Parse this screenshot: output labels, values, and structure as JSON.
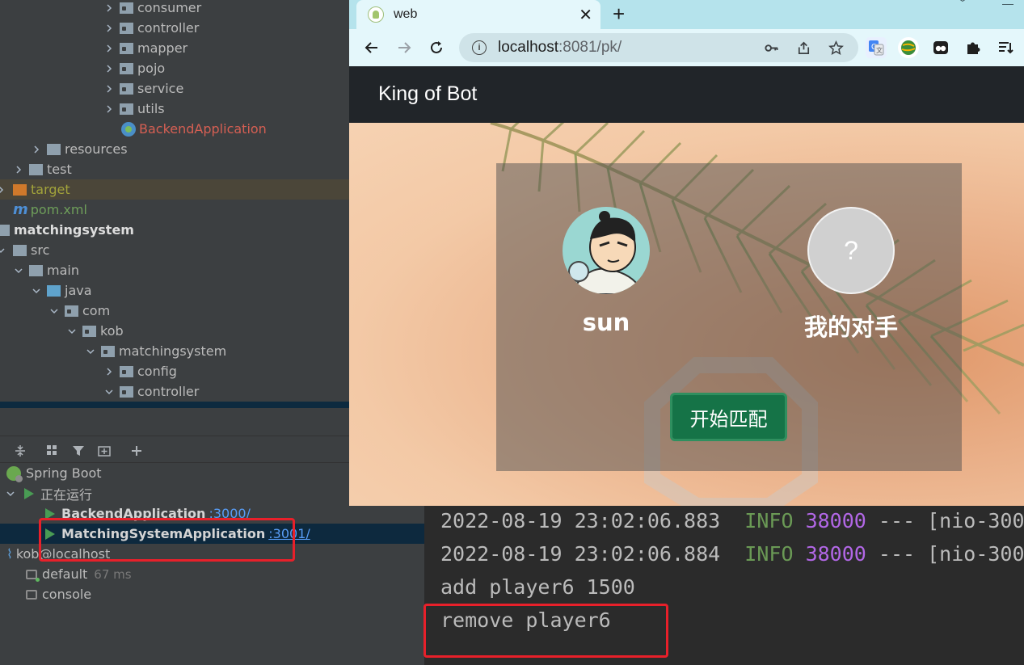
{
  "project_tree": {
    "items": [
      {
        "label": "consumer"
      },
      {
        "label": "controller"
      },
      {
        "label": "mapper"
      },
      {
        "label": "pojo"
      },
      {
        "label": "service"
      },
      {
        "label": "utils"
      },
      {
        "label": "BackendApplication"
      },
      {
        "label": "resources"
      },
      {
        "label": "test"
      },
      {
        "label": "target"
      },
      {
        "label": "pom.xml"
      },
      {
        "label": "matchingsystem"
      },
      {
        "label": "src"
      },
      {
        "label": "main"
      },
      {
        "label": "java"
      },
      {
        "label": "com"
      },
      {
        "label": "kob"
      },
      {
        "label": "matchingsystem"
      },
      {
        "label": "config"
      },
      {
        "label": "controller"
      }
    ]
  },
  "services": {
    "spring_boot_label": "Spring Boot",
    "running_label": "正在运行",
    "apps": [
      {
        "name": "BackendApplication",
        "port": ":3000/"
      },
      {
        "name": "MatchingSystemApplication",
        "port": ":3001/"
      }
    ],
    "datasource": {
      "label": "kob@localhost",
      "children": [
        {
          "label": "default",
          "timing": "67 ms"
        },
        {
          "label": "console"
        }
      ]
    }
  },
  "console": {
    "lines": [
      {
        "timestamp": "2022-08-19 23:02:06.883",
        "level": "INFO",
        "pid": "38000",
        "rest": "--- [nio-300"
      },
      {
        "timestamp": "2022-08-19 23:02:06.884",
        "level": "INFO",
        "pid": "38000",
        "rest": "--- [nio-300"
      },
      {
        "text": "add player6 1500"
      },
      {
        "text": "remove player6"
      }
    ]
  },
  "browser": {
    "tab_title": "web",
    "url_host": "localhost",
    "url_rest": ":8081/pk/",
    "page": {
      "brand": "King of Bot",
      "player_name": "sun",
      "opponent_name": "我的对手",
      "opponent_avatar_text": "?",
      "start_button_label": "开始匹配"
    }
  },
  "colors": {
    "highlight": "#e8202a",
    "start_button": "#157347",
    "navbar": "#212529"
  }
}
